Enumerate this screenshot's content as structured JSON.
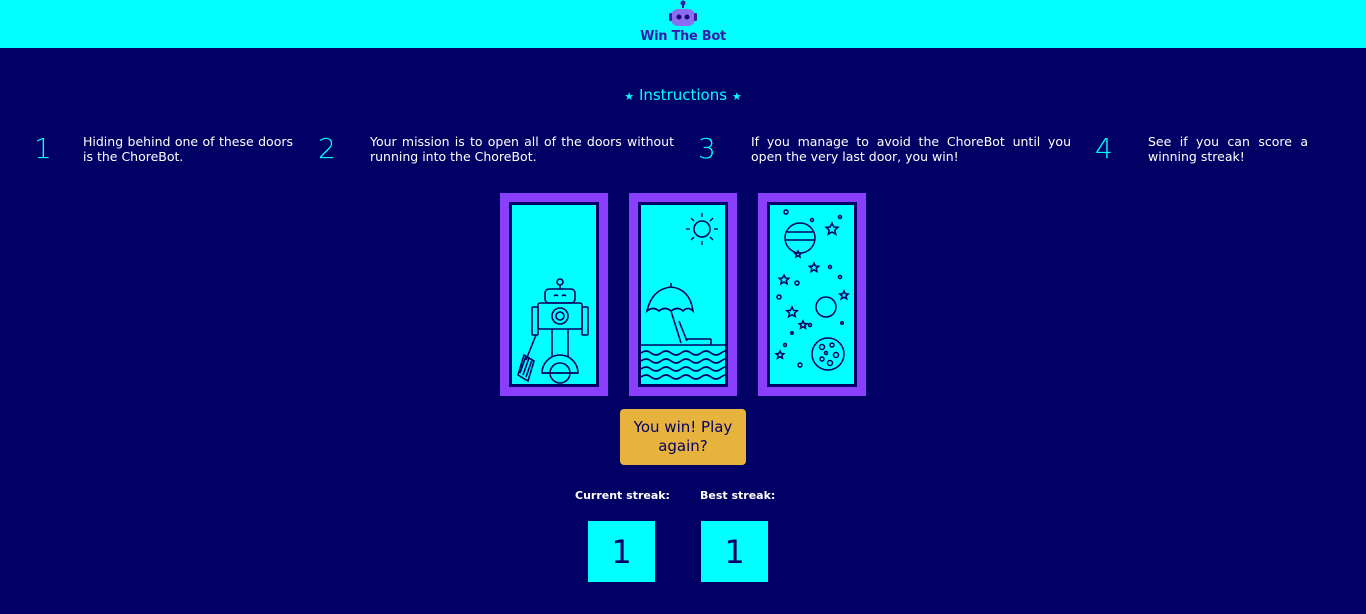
{
  "header": {
    "logo_text": "Win The Bot",
    "icon": "robot-head-icon"
  },
  "instructions": {
    "title": "Instructions",
    "star": "★",
    "steps": [
      {
        "number": "1",
        "text": "Hiding behind one of these doors is the ChoreBot."
      },
      {
        "number": "2",
        "text": "Your mission is to open all of the doors without running into the ChoreBot."
      },
      {
        "number": "3",
        "text": "If you manage to avoid the ChoreBot until you open the very last door, you win!"
      },
      {
        "number": "4",
        "text": "See if you can score a winning streak!"
      }
    ]
  },
  "doors": [
    {
      "scene": "robot-with-broom"
    },
    {
      "scene": "beach"
    },
    {
      "scene": "space"
    }
  ],
  "play_button": {
    "label": "You win! Play again?"
  },
  "streaks": {
    "current_label": "Current streak:",
    "current_value": "1",
    "best_label": "Best streak:",
    "best_value": "1"
  },
  "colors": {
    "background": "#010165",
    "topbar": "#00ffff",
    "door_frame": "#8a3ffc",
    "button": "#e8b33d"
  }
}
